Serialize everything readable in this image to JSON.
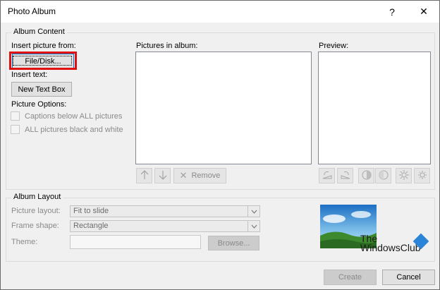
{
  "window": {
    "title": "Photo Album",
    "help_label": "?",
    "close_label": "✕"
  },
  "album_content": {
    "legend": "Album Content",
    "insert_picture_from": "Insert picture from:",
    "file_disk_button": "File/Disk...",
    "insert_text": "Insert text:",
    "new_text_box_button": "New Text Box",
    "picture_options": "Picture Options:",
    "captions_option": "Captions below ALL pictures",
    "black_white_option": "ALL pictures black and white",
    "pictures_in_album": "Pictures in album:",
    "preview": "Preview:",
    "remove_button": "Remove",
    "move_up_icon": "up-arrow-icon",
    "move_down_icon": "down-arrow-icon"
  },
  "album_layout": {
    "legend": "Album Layout",
    "picture_layout_label": "Picture layout:",
    "picture_layout_value": "Fit to slide",
    "frame_shape_label": "Frame shape:",
    "frame_shape_value": "Rectangle",
    "theme_label": "Theme:",
    "theme_value": "",
    "browse_button": "Browse..."
  },
  "watermark": {
    "line1": "The",
    "line2": "WindowsClub"
  },
  "footer": {
    "create_button": "Create",
    "cancel_button": "Cancel"
  }
}
